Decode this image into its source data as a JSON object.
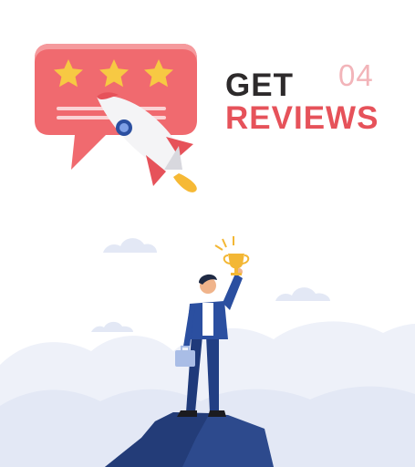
{
  "heading": {
    "line1": "GET",
    "line2": "REVIEWS"
  },
  "step_number": "04",
  "rating": {
    "stars": 3
  },
  "colors": {
    "accent": "#e6525a",
    "dark_text": "#2d2a2b",
    "step_number": "#f2b4b9",
    "bubble": "#f06a6f",
    "star": "#f7c943",
    "mountain": "#2d4a8d",
    "sky_cloud": "#e6ebf7"
  },
  "icons": [
    "review-bubble-icon",
    "star-icon",
    "rocket-icon",
    "trophy-icon"
  ]
}
